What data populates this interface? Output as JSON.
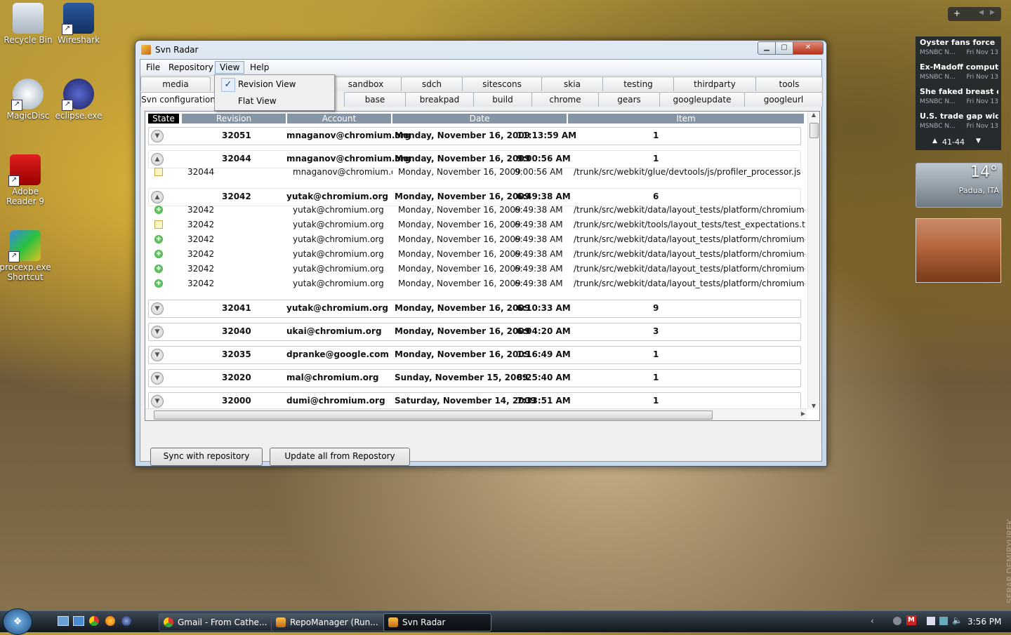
{
  "desktop": {
    "icons": [
      {
        "label": "Recycle Bin"
      },
      {
        "label": "Wireshark"
      },
      {
        "label": "MagicDisc"
      },
      {
        "label": "eclipse.exe"
      },
      {
        "label": "Adobe Reader 9"
      },
      {
        "label": "procexp.exe Shortcut"
      }
    ]
  },
  "window": {
    "title": "Svn Radar",
    "menu": [
      "File",
      "Repository",
      "View",
      "Help"
    ],
    "view_menu": {
      "items": [
        {
          "label": "Revision View",
          "checked": true
        },
        {
          "label": "Flat View",
          "checked": false
        }
      ]
    },
    "tabs_row1": [
      "media",
      "sandbox",
      "sdch",
      "sitescons",
      "skia",
      "testing",
      "thirdparty",
      "tools"
    ],
    "tabs_row2": [
      "Svn configuration",
      "base",
      "breakpad",
      "build",
      "chrome",
      "gears",
      "googleupdate",
      "googleurl"
    ],
    "columns": [
      "State",
      "Revision",
      "Account",
      "Date",
      "Item"
    ],
    "groups": [
      {
        "revision": "32051",
        "account": "mnaganov@chromium.org",
        "date": "Monday, November 16, 2009",
        "time": "11:13:59 AM",
        "count": "1",
        "expanded": false,
        "children": []
      },
      {
        "revision": "32044",
        "account": "mnaganov@chromium.org",
        "date": "Monday, November 16, 2009",
        "time": "9:00:56 AM",
        "count": "1",
        "expanded": true,
        "children": [
          {
            "type": "mod",
            "revision": "32044",
            "account": "mnaganov@chromium.org",
            "date": "Monday, November 16, 2009",
            "time": "9:00:56 AM",
            "item": "/trunk/src/webkit/glue/devtools/js/profiler_processor.js"
          }
        ]
      },
      {
        "revision": "32042",
        "account": "yutak@chromium.org",
        "date": "Monday, November 16, 2009",
        "time": "6:49:38 AM",
        "count": "6",
        "expanded": true,
        "children": [
          {
            "type": "add",
            "revision": "32042",
            "account": "yutak@chromium.org",
            "date": "Monday, November 16, 2009",
            "time": "6:49:38 AM",
            "item": "/trunk/src/webkit/data/layout_tests/platform/chromium-win/L"
          },
          {
            "type": "mod",
            "revision": "32042",
            "account": "yutak@chromium.org",
            "date": "Monday, November 16, 2009",
            "time": "6:49:38 AM",
            "item": "/trunk/src/webkit/tools/layout_tests/test_expectations.txt"
          },
          {
            "type": "add",
            "revision": "32042",
            "account": "yutak@chromium.org",
            "date": "Monday, November 16, 2009",
            "time": "6:49:38 AM",
            "item": "/trunk/src/webkit/data/layout_tests/platform/chromium-win/L"
          },
          {
            "type": "add",
            "revision": "32042",
            "account": "yutak@chromium.org",
            "date": "Monday, November 16, 2009",
            "time": "6:49:38 AM",
            "item": "/trunk/src/webkit/data/layout_tests/platform/chromium-linux"
          },
          {
            "type": "add",
            "revision": "32042",
            "account": "yutak@chromium.org",
            "date": "Monday, November 16, 2009",
            "time": "6:49:38 AM",
            "item": "/trunk/src/webkit/data/layout_tests/platform/chromium-win/L"
          },
          {
            "type": "add",
            "revision": "32042",
            "account": "yutak@chromium.org",
            "date": "Monday, November 16, 2009",
            "time": "6:49:38 AM",
            "item": "/trunk/src/webkit/data/layout_tests/platform/chromium-linux"
          }
        ]
      },
      {
        "revision": "32041",
        "account": "yutak@chromium.org",
        "date": "Monday, November 16, 2009",
        "time": "6:10:33 AM",
        "count": "9",
        "expanded": false,
        "children": []
      },
      {
        "revision": "32040",
        "account": "ukai@chromium.org",
        "date": "Monday, November 16, 2009",
        "time": "6:04:20 AM",
        "count": "3",
        "expanded": false,
        "children": []
      },
      {
        "revision": "32035",
        "account": "dpranke@google.com",
        "date": "Monday, November 16, 2009",
        "time": "1:16:49 AM",
        "count": "1",
        "expanded": false,
        "children": []
      },
      {
        "revision": "32020",
        "account": "mal@chromium.org",
        "date": "Sunday, November 15, 2009",
        "time": "8:25:40 AM",
        "count": "1",
        "expanded": false,
        "children": []
      },
      {
        "revision": "32000",
        "account": "dumi@chromium.org",
        "date": "Saturday, November 14, 2009",
        "time": "7:33:51 AM",
        "count": "1",
        "expanded": false,
        "children": []
      }
    ],
    "buttons": {
      "sync": "Sync with repository",
      "update": "Update all from Repostory"
    }
  },
  "sidebar": {
    "news": [
      {
        "headline": "Oyster fans force FD...",
        "source": "MSNBC N...",
        "date": "Fri Nov 13"
      },
      {
        "headline": "Ex-Madoff computer...",
        "source": "MSNBC N...",
        "date": "Fri Nov 13"
      },
      {
        "headline": "She faked breast can...",
        "source": "MSNBC N...",
        "date": "Fri Nov 13"
      },
      {
        "headline": "U.S. trade gap widen...",
        "source": "MSNBC N...",
        "date": "Fri Nov 13"
      }
    ],
    "pager": "41-44",
    "weather": {
      "temp": "14°",
      "city": "Padua, ITA"
    },
    "watermark": "SERAP DEMIRYUREK"
  },
  "taskbar": {
    "tasks": [
      "Gmail - From Cathe...",
      "RepoManager (Run...",
      "Svn Radar"
    ],
    "clock": "3:56 PM"
  },
  "colors": {
    "header_bg": "#8595a5",
    "add_icon": "#2ea12e",
    "close_button": "#b6321a"
  }
}
